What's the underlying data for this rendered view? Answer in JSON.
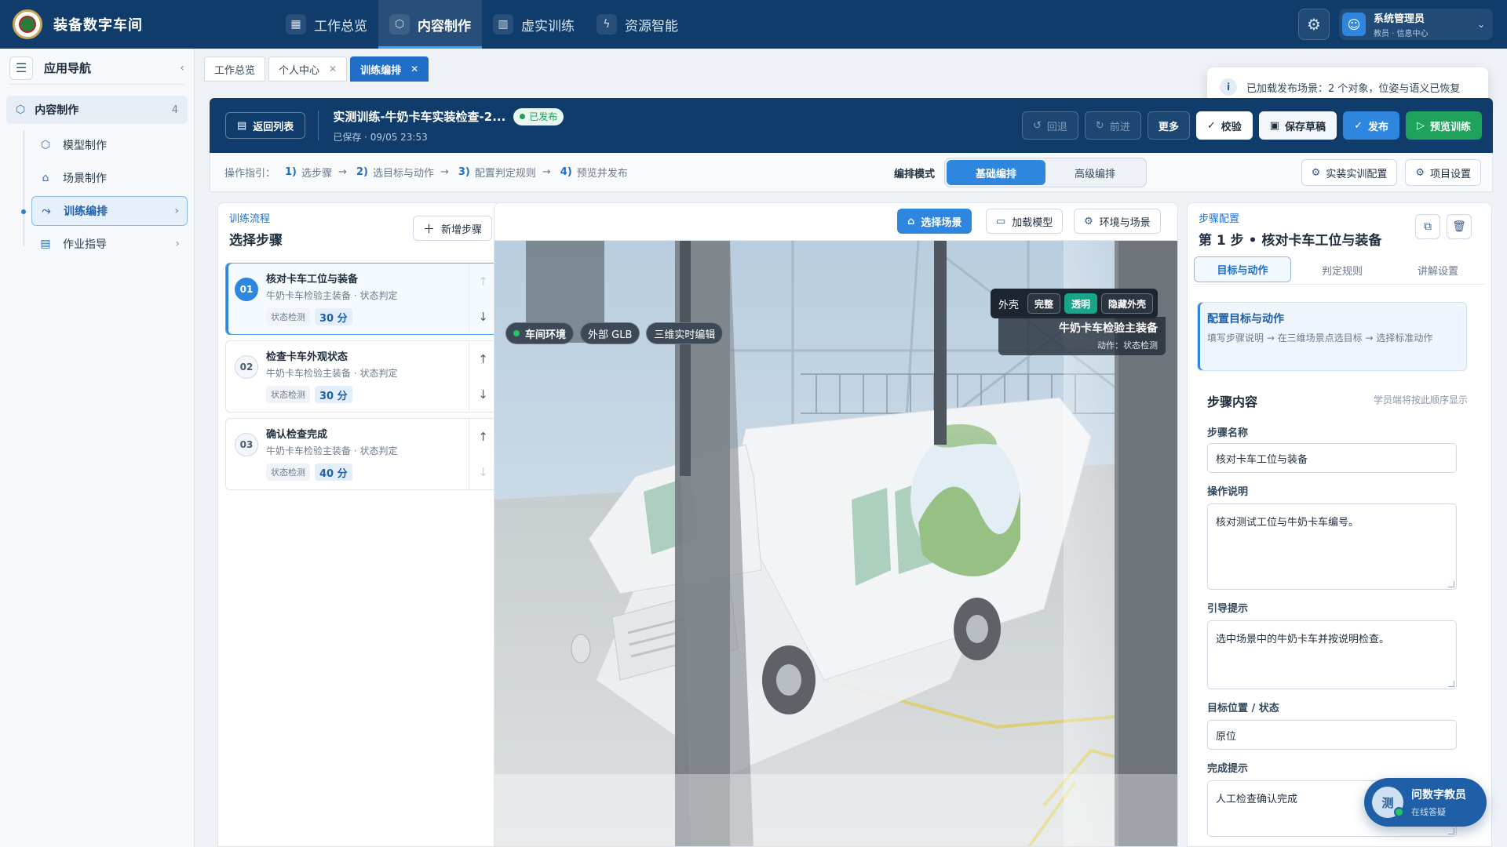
{
  "app": {
    "brand": "装备数字车间"
  },
  "topnav": {
    "tabs": [
      {
        "label": "工作总览",
        "icon": "grid-icon"
      },
      {
        "label": "内容制作",
        "icon": "cube-icon"
      },
      {
        "label": "虚实训练",
        "icon": "book-icon"
      },
      {
        "label": "资源智能",
        "icon": "ai-icon"
      }
    ],
    "active_tab": "内容制作",
    "user": {
      "name": "系统管理员",
      "role": "教员 · 信息中心"
    }
  },
  "sidebar": {
    "title": "应用导航",
    "group": {
      "label": "内容制作",
      "count": "4"
    },
    "items": [
      {
        "label": "模型制作",
        "icon": "cube-icon"
      },
      {
        "label": "场景制作",
        "icon": "home-icon"
      },
      {
        "label": "训练编排",
        "icon": "flow-icon",
        "active": true
      },
      {
        "label": "作业指导",
        "icon": "doc-icon"
      }
    ]
  },
  "tabs": [
    {
      "label": "工作总览"
    },
    {
      "label": "个人中心"
    },
    {
      "label": "训练编排",
      "active": true
    }
  ],
  "toast": {
    "text": "已加载发布场景：2 个对象，位姿与语义已恢复"
  },
  "header": {
    "back_label": "返回列表",
    "title": "实测训练-牛奶卡车实装检查-2...",
    "status_badge": "已发布",
    "saved": "已保存 · 09/05 23:53",
    "buttons": {
      "undo": "回退",
      "redo": "前进",
      "more": "更多",
      "validate": "校验",
      "save_draft": "保存草稿",
      "publish": "发布",
      "preview": "预览训练"
    }
  },
  "guide": {
    "prefix": "操作指引：",
    "steps": [
      {
        "n": "1)",
        "label": "选步骤"
      },
      {
        "n": "2)",
        "label": "选目标与动作"
      },
      {
        "n": "3)",
        "label": "配置判定规则"
      },
      {
        "n": "4)",
        "label": "预览并发布"
      }
    ],
    "mode_label": "编排模式",
    "modes": [
      "基础编排",
      "高级编排"
    ],
    "active_mode": "基础编排",
    "btn_equipment": "实装实训配置",
    "btn_project": "项目设置"
  },
  "steps_panel": {
    "kicker": "训练流程",
    "title": "选择步骤",
    "add_label": "新增步骤",
    "steps": [
      {
        "num": "01",
        "title": "核对卡车工位与装备",
        "subtitle": "牛奶卡车检验主装备 · 状态判定",
        "tag": "状态检测",
        "score": "30 分",
        "selected": true
      },
      {
        "num": "02",
        "title": "检查卡车外观状态",
        "subtitle": "牛奶卡车检验主装备 · 状态判定",
        "tag": "状态检测",
        "score": "30 分"
      },
      {
        "num": "03",
        "title": "确认检查完成",
        "subtitle": "牛奶卡车检验主装备 · 状态判定",
        "tag": "状态检测",
        "score": "40 分"
      }
    ]
  },
  "viewport": {
    "toolbar": {
      "select_scene": "选择场景",
      "load_model": "加载模型",
      "env_scene": "环境与场景"
    },
    "chips": [
      "车间环境",
      "外部 GLB",
      "三维实时编辑"
    ],
    "shell": {
      "label": "外壳",
      "options": [
        "完整",
        "透明",
        "隐藏外壳"
      ],
      "active": "透明"
    },
    "object": {
      "name": "牛奶卡车检验主装备",
      "action": "动作：状态检测"
    }
  },
  "right_panel": {
    "kicker": "步骤配置",
    "title": "第 1 步 • 核对卡车工位与装备",
    "tabs": [
      "目标与动作",
      "判定规则",
      "讲解设置"
    ],
    "active_tab": "目标与动作",
    "config_title": "配置目标与动作",
    "config_desc": "填写步骤说明 → 在三维场景点选目标 → 选择标准动作",
    "section_title": "步骤内容",
    "section_note": "学员端将按此顺序显示",
    "fields": {
      "name_label": "步骤名称",
      "name_value": "核对卡车工位与装备",
      "desc_label": "操作说明",
      "desc_value": "核对测试工位与牛奶卡车编号。",
      "hint_label": "引导提示",
      "hint_value": "选中场景中的牛奶卡车并按说明检查。",
      "target_label": "目标位置 / 状态",
      "target_value": "原位",
      "done_label": "完成提示",
      "done_value": "人工检查确认完成"
    }
  },
  "assistant": {
    "avatar": "测",
    "title": "问数字教员",
    "status": "在线答疑"
  }
}
